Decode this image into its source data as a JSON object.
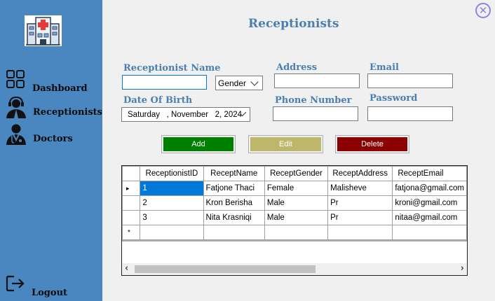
{
  "colors": {
    "sidebar": "#4a86c0",
    "accent": "#4a7fb0",
    "add": "#008000",
    "edit": "#bdb76b",
    "delete": "#8b0000"
  },
  "sidebar": {
    "items": [
      {
        "label": "Dashboard",
        "icon": "dashboard-grid-icon"
      },
      {
        "label": "Receptionists",
        "icon": "receptionist-icon"
      },
      {
        "label": "Doctors",
        "icon": "doctor-icon"
      }
    ],
    "logout": {
      "label": "Logout",
      "icon": "logout-icon"
    },
    "logo": "hospital-logo-icon"
  },
  "header": {
    "title": "Receptionists",
    "close_icon": "close-icon"
  },
  "form": {
    "name_label": "Receptionist Name",
    "name_value": "",
    "gender_value": "Gender",
    "address_label": "Address",
    "address_value": "",
    "email_label": "Email",
    "email_value": "",
    "dob_label": "Date Of Birth",
    "dob_value": "Saturday   , November   2, 2024",
    "phone_label": "Phone Number",
    "phone_value": "",
    "password_label": "Password",
    "password_value": ""
  },
  "buttons": {
    "add": "Add",
    "edit": "Edit",
    "delete": "Delete"
  },
  "grid": {
    "columns": [
      "ReceptionistID",
      "ReceptName",
      "ReceptGender",
      "ReceptAddress",
      "ReceptEmail"
    ],
    "rows": [
      [
        "1",
        "Fatjone Thaci",
        "Female",
        "Malisheve",
        "fatjona@gmail.com"
      ],
      [
        "2",
        "Kron Berisha",
        "Male",
        "Pr",
        "kroni@gmail.com"
      ],
      [
        "3",
        "Nita Krasniqi",
        "Male",
        "Pr",
        "nitaa@gmail.com"
      ]
    ],
    "new_row_marker": "*",
    "current_row_marker": "▸",
    "scroll_left": "‹",
    "scroll_right": "›"
  }
}
